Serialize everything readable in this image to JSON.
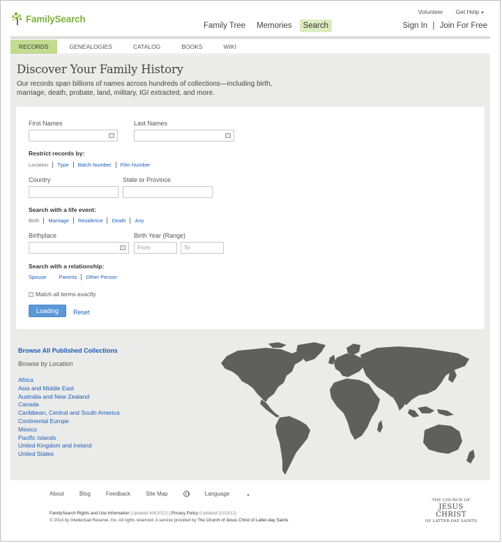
{
  "header": {
    "brand": "FamilySearch",
    "nav": [
      "Family Tree",
      "Memories",
      "Search"
    ],
    "active_nav": "Search",
    "util_links": [
      "Volunteer",
      "Get Help"
    ],
    "sign_in": "Sign In",
    "sep": "|",
    "join": "Join For Free"
  },
  "subnav": [
    "RECORDS",
    "GENEALOGIES",
    "CATALOG",
    "BOOKS",
    "WIKI"
  ],
  "page": {
    "title": "Discover Your Family History",
    "subtitle": "Our records span billions of names across hundreds of collections—including birth, marriage, death, probate, land, military, IGI extracted, and more."
  },
  "form": {
    "first_names_label": "First Names",
    "last_names_label": "Last Names",
    "restrict_label": "Restrict records by:",
    "restrict_options": [
      "Location",
      "Type",
      "Batch Number",
      "Film Number"
    ],
    "country_label": "Country",
    "state_label": "State or Province",
    "life_event_label": "Search with a life event:",
    "life_event_options": [
      "Birth",
      "Marriage",
      "Residence",
      "Death",
      "Any"
    ],
    "birthplace_label": "Birthplace",
    "birth_year_label": "Birth Year (Range)",
    "from_placeholder": "From",
    "to_placeholder": "To",
    "relationship_label": "Search with a relationship:",
    "relationship_options": [
      "Spouse",
      "Parents",
      "Other Person"
    ],
    "match_exact": "Match all terms exactly",
    "submit": "Loading",
    "reset": "Reset"
  },
  "browse": {
    "all": "Browse All Published Collections",
    "by_location": "Browse by Location",
    "locations": [
      "Africa",
      "Asia and Middle East",
      "Australia and New Zealand",
      "Canada",
      "Caribbean, Central and South America",
      "Continental Europe",
      "Mexico",
      "Pacific Islands",
      "United Kingdom and Ireland",
      "United States"
    ]
  },
  "footer": {
    "links": [
      "About",
      "Blog",
      "Feedback",
      "Site Map"
    ],
    "language": "Language",
    "rights": "FamilySearch Rights and Use Information",
    "rights_updated": "(Updated 6/4/2012)",
    "privacy": "Privacy Policy",
    "privacy_updated": "(Updated 2/1/2012)",
    "copyright": "© 2014 by Intellectual Reserve, Inc. All rights reserved. A service provided by",
    "church_link": "The Church of Jesus Christ of Latter-day Saints",
    "church_logo": [
      "THE CHURCH OF",
      "JESUS CHRIST",
      "OF LATTER-DAY SAINTS"
    ]
  },
  "colors": {
    "brand_green": "#7cb13d",
    "link_blue": "#1a5db8",
    "active_tab": "#c2dc8f",
    "map_gray": "#5f5f5d"
  }
}
